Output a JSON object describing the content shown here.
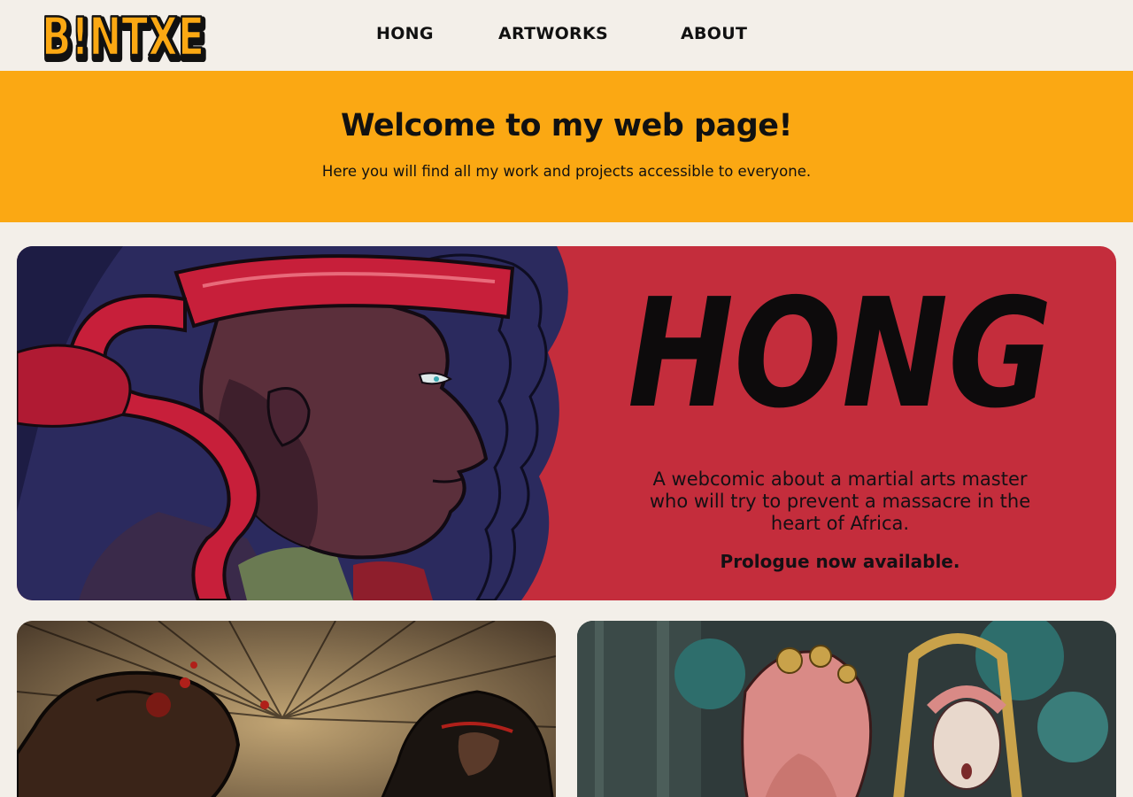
{
  "header": {
    "logo_text": "B!NTXE",
    "nav": [
      {
        "label": "HONG"
      },
      {
        "label": "ARTWORKS"
      },
      {
        "label": "ABOUT"
      }
    ]
  },
  "banner": {
    "title": "Welcome to my web page!",
    "subtitle": "Here you will find all my work and projects accessible to everyone."
  },
  "hero": {
    "wordmark": "HONG",
    "description": "A webcomic about a martial arts master who will try to prevent a massacre in the heart of Africa.",
    "cta": "Prologue now available."
  },
  "colors": {
    "page_bg": "#f3efe9",
    "accent_orange": "#fba813",
    "hero_red": "#c42d3c",
    "text_dark": "#111111"
  }
}
